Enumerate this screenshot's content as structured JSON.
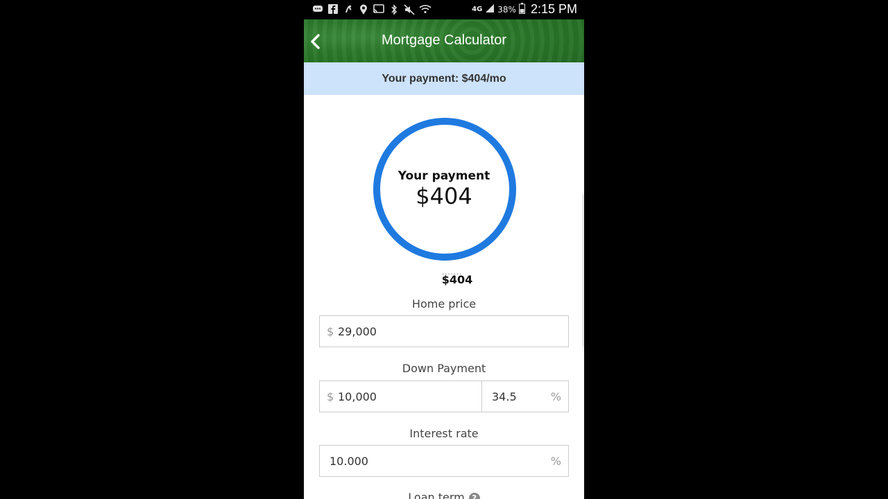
{
  "status_bar": {
    "network": "4G",
    "battery": "38%",
    "time": "2:15 PM",
    "icons": [
      "message-icon",
      "facebook-icon",
      "app-icon",
      "location-icon",
      "cast-icon",
      "bluetooth-icon",
      "mute-icon",
      "wifi-icon",
      "signal-icon",
      "battery-icon"
    ]
  },
  "header": {
    "title": "Mortgage Calculator"
  },
  "summary": {
    "text": "Your payment: $404/mo"
  },
  "chart": {
    "center_label": "Your payment",
    "center_value": "$404",
    "legend_dots": ".......",
    "legend_value": "$404",
    "ring_color": "#1f7ae0",
    "ring_fraction": 1.0
  },
  "fields": {
    "home_price": {
      "label": "Home price",
      "prefix": "$",
      "value": "29,000"
    },
    "down_payment": {
      "label": "Down Payment",
      "prefix": "$",
      "value": "10,000",
      "percent_value": "34.5",
      "percent_suffix": "%"
    },
    "interest_rate": {
      "label": "Interest rate",
      "value": "10.000",
      "suffix": "%"
    },
    "loan_term": {
      "label": "Loan term",
      "help": "?"
    }
  },
  "colors": {
    "header_green": "#2c7a2c",
    "summary_bg": "#cde2fb",
    "accent_blue": "#1f7ae0"
  }
}
